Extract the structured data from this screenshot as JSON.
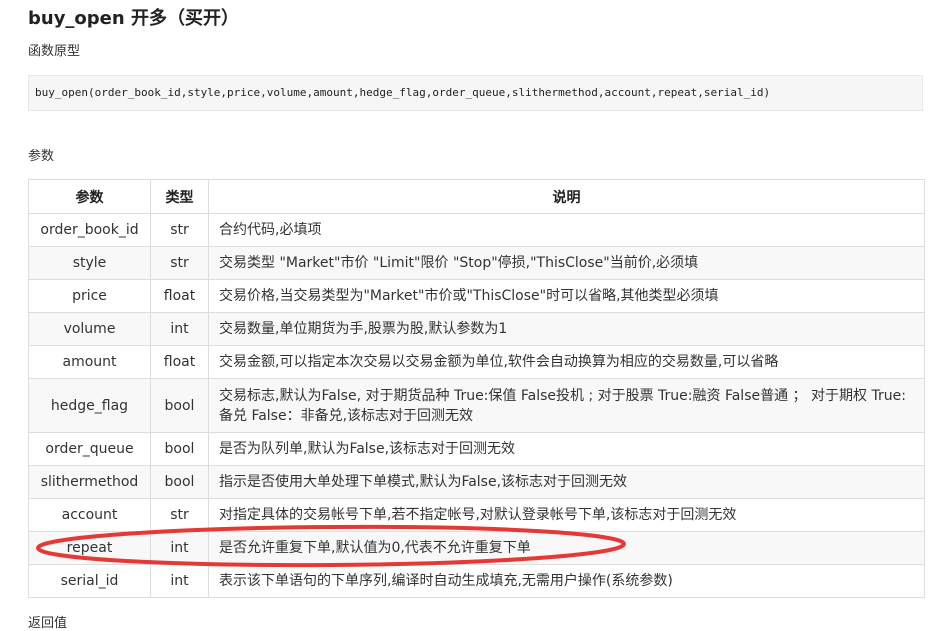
{
  "title": "buy_open 开多（买开）",
  "prototype_label": "函数原型",
  "prototype_code": "buy_open(order_book_id,style,price,volume,amount,hedge_flag,order_queue,slithermethod,account,repeat,serial_id)",
  "params_label": "参数",
  "table": {
    "headers": [
      "参数",
      "类型",
      "说明"
    ],
    "rows": [
      {
        "name": "order_book_id",
        "type": "str",
        "desc": "合约代码,必填项"
      },
      {
        "name": "style",
        "type": "str",
        "desc": "交易类型 \"Market\"市价 \"Limit\"限价 \"Stop\"停损,\"ThisClose\"当前价,必须填"
      },
      {
        "name": "price",
        "type": "float",
        "desc": "交易价格,当交易类型为\"Market\"市价或\"ThisClose\"时可以省略,其他类型必须填"
      },
      {
        "name": "volume",
        "type": "int",
        "desc": "交易数量,单位期货为手,股票为股,默认参数为1"
      },
      {
        "name": "amount",
        "type": "float",
        "desc": "交易金额,可以指定本次交易以交易金额为单位,软件会自动换算为相应的交易数量,可以省略"
      },
      {
        "name": "hedge_flag",
        "type": "bool",
        "desc": "交易标志,默认为False, 对于期货品种 True:保值 False投机 ; 对于股票 True:融资 False普通 ； 对于期权 True:备兑 False：非备兑,该标志对于回测无效"
      },
      {
        "name": "order_queue",
        "type": "bool",
        "desc": "是否为队列单,默认为False,该标志对于回测无效"
      },
      {
        "name": "slithermethod",
        "type": "bool",
        "desc": "指示是否使用大单处理下单模式,默认为False,该标志对于回测无效"
      },
      {
        "name": "account",
        "type": "str",
        "desc": "对指定具体的交易帐号下单,若不指定帐号,对默认登录帐号下单,该标志对于回测无效"
      },
      {
        "name": "repeat",
        "type": "int",
        "desc": "是否允许重复下单,默认值为0,代表不允许重复下单"
      },
      {
        "name": "serial_id",
        "type": "int",
        "desc": "表示该下单语句的下单序列,编译时自动生成填充,无需用户操作(系统参数)"
      }
    ]
  },
  "return_label": "返回值",
  "annotation_color": "#e53935"
}
